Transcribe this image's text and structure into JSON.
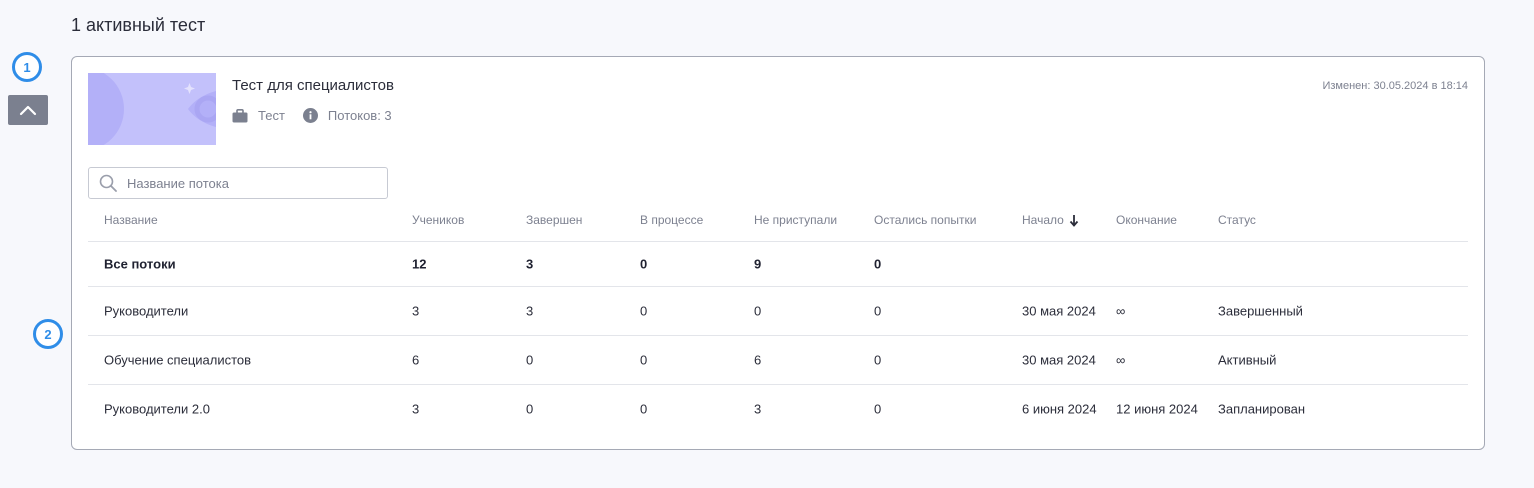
{
  "page": {
    "heading": "1 активный тест"
  },
  "markers": [
    "1",
    "2"
  ],
  "card": {
    "title": "Тест для специалистов",
    "type_label": "Тест",
    "streams_label": "Потоков: 3",
    "modified": "Изменен: 30.05.2024 в 18:14"
  },
  "search": {
    "placeholder": "Название потока",
    "value": ""
  },
  "table": {
    "columns": [
      "Название",
      "Учеников",
      "Завершен",
      "В процессе",
      "Не приступали",
      "Остались попытки",
      "Начало",
      "Окончание",
      "Статус"
    ],
    "sorted_column": "Начало",
    "summary": [
      "Все потоки",
      "12",
      "3",
      "0",
      "9",
      "0",
      "",
      "",
      ""
    ],
    "rows": [
      [
        "Руководители",
        "3",
        "3",
        "0",
        "0",
        "0",
        "30 мая 2024",
        "∞",
        "Завершенный"
      ],
      [
        "Обучение специалистов",
        "6",
        "0",
        "0",
        "6",
        "0",
        "30 мая 2024",
        "∞",
        "Активный"
      ],
      [
        "Руководители 2.0",
        "3",
        "0",
        "0",
        "3",
        "0",
        "6 июня 2024",
        "12 июня 2024",
        "Запланирован"
      ]
    ]
  }
}
